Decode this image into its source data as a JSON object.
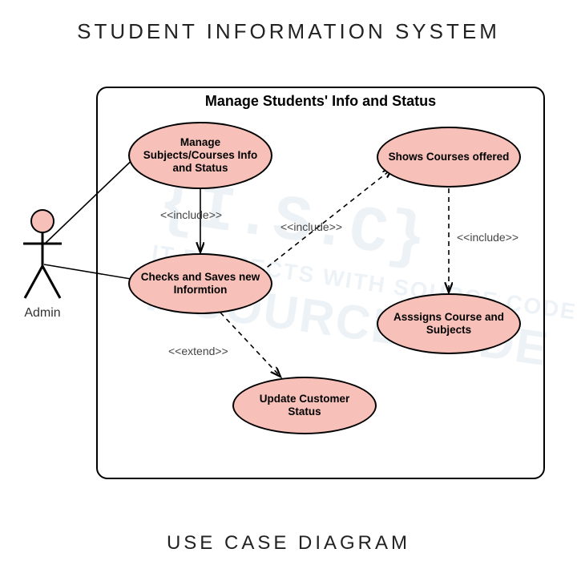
{
  "title": "STUDENT INFORMATION SYSTEM",
  "caption": "USE CASE DIAGRAM",
  "system": {
    "title": "Manage Students' Info and Status"
  },
  "actor": {
    "label": "Admin"
  },
  "usecases": {
    "uc1": "Manage Subjects/Courses Info and Status",
    "uc2": "Checks and Saves new Informtion",
    "uc3": "Update Customer Status",
    "uc4": "Shows Courses offered",
    "uc5": "Asssigns Course and Subjects"
  },
  "stereotypes": {
    "include": "<<include>>",
    "extend": "<<extend>>"
  },
  "watermark": {
    "logo": "{I.S.C}",
    "text": "IT PROJECTS WITH SOURCE CODE",
    "brand": "ITSOURCECODE"
  }
}
